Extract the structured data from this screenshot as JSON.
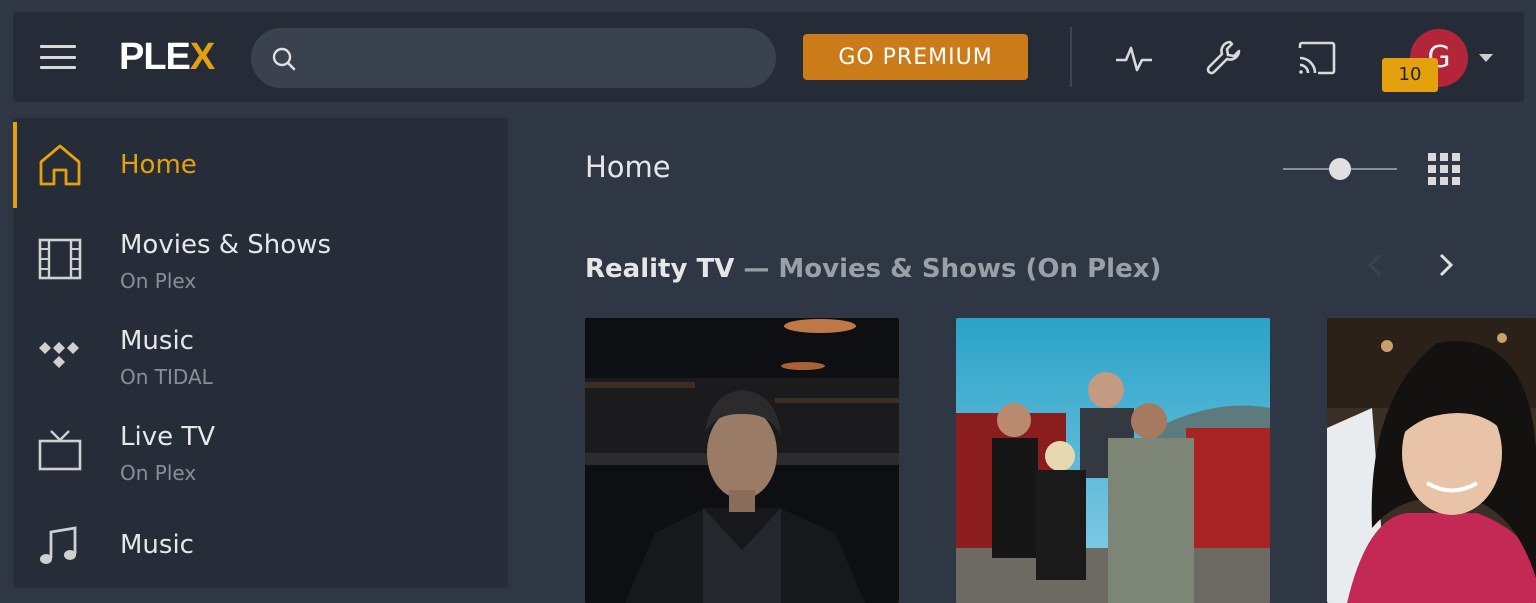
{
  "topbar": {
    "logo": {
      "text_main": "PLE",
      "text_accent": "X"
    },
    "search": {
      "placeholder": "",
      "value": ""
    },
    "premium_label": "GO PREMIUM",
    "icons": [
      "activity-icon",
      "wrench-icon",
      "cast-icon"
    ],
    "avatar_initial": "G",
    "notification_count": "10",
    "colors": {
      "accent": "#e5a00d",
      "premium": "#cc7b19",
      "avatar": "#b3263a"
    }
  },
  "sidebar": {
    "items": [
      {
        "label": "Home",
        "sub": "",
        "icon": "home-icon",
        "active": true
      },
      {
        "label": "Movies & Shows",
        "sub": "On Plex",
        "icon": "film-icon",
        "active": false
      },
      {
        "label": "Music",
        "sub": "On TIDAL",
        "icon": "tidal-icon",
        "active": false
      },
      {
        "label": "Live TV",
        "sub": "On Plex",
        "icon": "tv-icon",
        "active": false
      },
      {
        "label": "Music",
        "sub": "",
        "icon": "music-note-icon",
        "active": false
      }
    ]
  },
  "main": {
    "title": "Home",
    "size_slider_value": 0.5,
    "section": {
      "title": "Reality TV",
      "separator": " — ",
      "subtitle": "Movies & Shows (On Plex)"
    },
    "cards": [
      {
        "name": "poster-1"
      },
      {
        "name": "poster-2"
      },
      {
        "name": "poster-3"
      }
    ]
  }
}
